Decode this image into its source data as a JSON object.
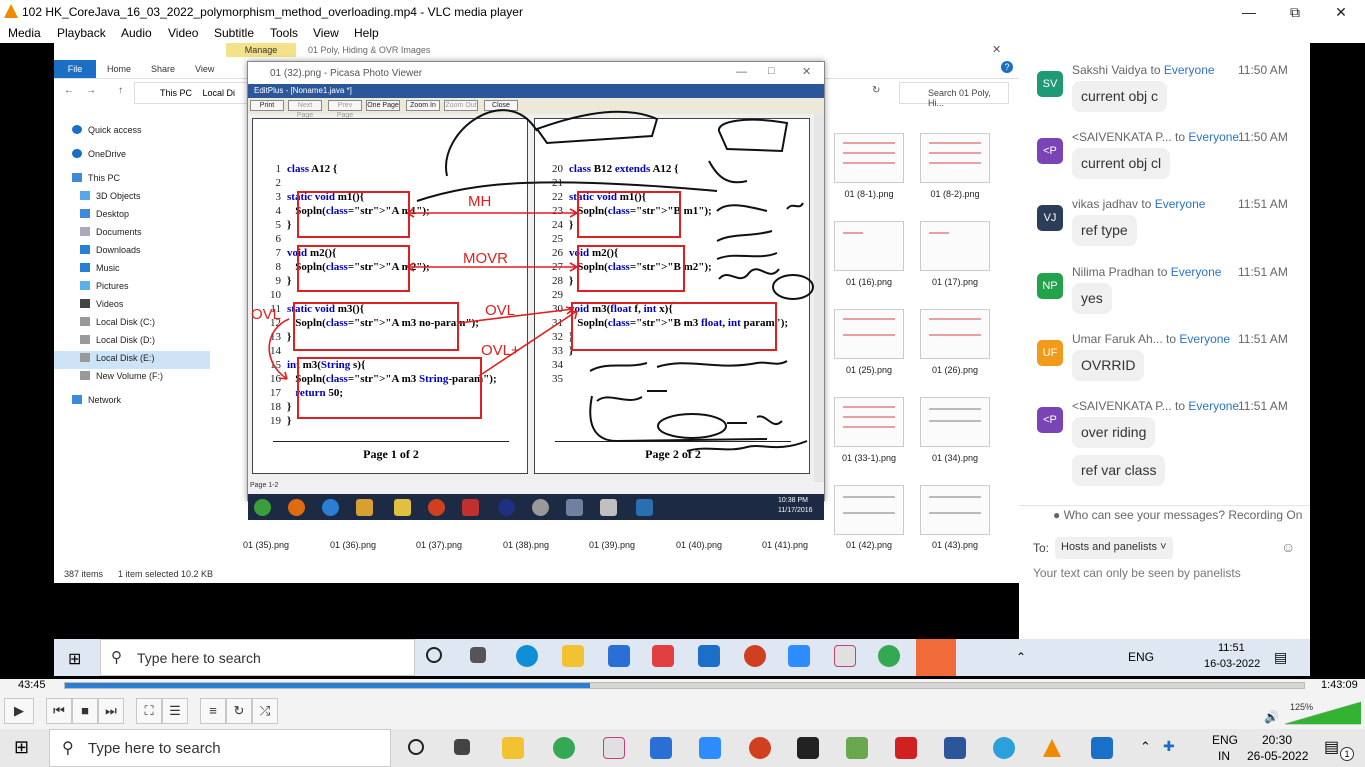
{
  "vlc": {
    "title": "102 HK_CoreJava_16_03_2022_polymorphism_method_overloading.mp4 - VLC media player",
    "menu": [
      "Media",
      "Playback",
      "Audio",
      "Video",
      "Subtitle",
      "Tools",
      "View",
      "Help"
    ],
    "time_elapsed": "43:45",
    "time_total": "1:43:09",
    "progress": 0.424,
    "volume_label": "125%"
  },
  "explorer": {
    "ribbon_tabs": [
      "File",
      "Home",
      "Share",
      "View"
    ],
    "manage_label": "Manage",
    "window_title": "01 Poly, Hiding & OVR Images",
    "breadcrumb": [
      "This PC",
      "Local Di"
    ],
    "search_placeholder": "Search 01 Poly, Hi...",
    "nav_items": [
      "Quick access",
      "OneDrive",
      "This PC",
      "3D Objects",
      "Desktop",
      "Documents",
      "Downloads",
      "Music",
      "Pictures",
      "Videos",
      "Local Disk (C:)",
      "Local Disk (D:)",
      "Local Disk (E:)",
      "New Volume (F:)",
      "Network"
    ],
    "status_items": "387 items",
    "status_selected": "1 item selected  10.2 KB",
    "thumbnails": [
      "01 (8-1).png",
      "01 (8-2).png",
      "01 (16).png",
      "01 (17).png",
      "01 (25).png",
      "01 (26).png",
      "01 (33-1).png",
      "01 (34).png",
      "01 (35).png",
      "01 (36).png",
      "01 (37).png",
      "01 (38).png",
      "01 (39).png",
      "01 (40).png",
      "01 (41).png",
      "01 (42).png",
      "01 (43).png"
    ]
  },
  "picasa": {
    "title": "01 (32).png - Picasa Photo Viewer",
    "inner_title": "EditPlus - [Noname1.java *]",
    "toolbar": [
      "Print",
      "Next Page",
      "Prev Page",
      "One Page",
      "Zoom In",
      "Zoom Out",
      "Close"
    ],
    "page1_label": "Page 1 of 2",
    "page2_label": "Page 2 of 2",
    "status": "Page 1-2",
    "clock": "10:38 PM",
    "clock_date": "11/17/2016",
    "page1_lines": [
      {
        "n": "1",
        "t": "class A12 {"
      },
      {
        "n": "2",
        "t": ""
      },
      {
        "n": "3",
        "t": "static void m1(){"
      },
      {
        "n": "4",
        "t": "   Sopln(\"A m1\");"
      },
      {
        "n": "5",
        "t": "}"
      },
      {
        "n": "6",
        "t": ""
      },
      {
        "n": "7",
        "t": "void m2(){"
      },
      {
        "n": "8",
        "t": "   Sopln(\"A m2\");"
      },
      {
        "n": "9",
        "t": "}"
      },
      {
        "n": "10",
        "t": ""
      },
      {
        "n": "11",
        "t": "static void m3(){"
      },
      {
        "n": "12",
        "t": "   Sopln(\"A m3 no-param\");"
      },
      {
        "n": "13",
        "t": "}"
      },
      {
        "n": "14",
        "t": ""
      },
      {
        "n": "15",
        "t": "int m3(String s){"
      },
      {
        "n": "16",
        "t": "   Sopln(\"A m3 String-param\");"
      },
      {
        "n": "17",
        "t": "   return 50;"
      },
      {
        "n": "18",
        "t": "}"
      },
      {
        "n": "19",
        "t": "}"
      }
    ],
    "page2_lines": [
      {
        "n": "20",
        "t": "class B12 extends A12 {"
      },
      {
        "n": "21",
        "t": ""
      },
      {
        "n": "22",
        "t": "static void m1(){"
      },
      {
        "n": "23",
        "t": "   Sopln(\"B m1\");"
      },
      {
        "n": "24",
        "t": "}"
      },
      {
        "n": "25",
        "t": ""
      },
      {
        "n": "26",
        "t": "void m2(){"
      },
      {
        "n": "27",
        "t": "   Sopln(\"B m2\");"
      },
      {
        "n": "28",
        "t": "}"
      },
      {
        "n": "29",
        "t": ""
      },
      {
        "n": "30",
        "t": "void m3(float f, int x){"
      },
      {
        "n": "31",
        "t": "   Sopln(\"B m3 float, int param\");"
      },
      {
        "n": "32",
        "t": "}"
      },
      {
        "n": "33",
        "t": "}"
      },
      {
        "n": "34",
        "t": ""
      },
      {
        "n": "35",
        "t": ""
      }
    ],
    "annotations": {
      "mh": "MH",
      "movr": "MOVR",
      "ovl_left": "OVL",
      "ovl_right": "OVL",
      "ovl_plus": "OVL+"
    }
  },
  "chat": {
    "messages": [
      {
        "initials": "SV",
        "color": "#1f9a74",
        "sender": "Sakshi Vaidya",
        "to": "Everyone",
        "time": "11:50 AM",
        "texts": [
          "current obj c"
        ]
      },
      {
        "initials": "<P",
        "color": "#7a43b6",
        "sender": "<SAIVENKATA P...",
        "to": "Everyone",
        "time": "11:50 AM",
        "texts": [
          "current obj cl"
        ]
      },
      {
        "initials": "VJ",
        "color": "#2b3e57",
        "sender": "vikas jadhav",
        "to": "Everyone",
        "time": "11:51 AM",
        "texts": [
          "ref type"
        ]
      },
      {
        "initials": "NP",
        "color": "#22a24a",
        "sender": "Nilima Pradhan",
        "to": "Everyone",
        "time": "11:51 AM",
        "texts": [
          "yes"
        ]
      },
      {
        "initials": "UF",
        "color": "#f29a1a",
        "sender": "Umar Faruk Ah...",
        "to": "Everyone",
        "time": "11:51 AM",
        "texts": [
          "OVRRID"
        ]
      },
      {
        "initials": "<P",
        "color": "#7a43b6",
        "sender": "<SAIVENKATA P...",
        "to": "Everyone",
        "time": "11:51 AM",
        "texts": [
          "over riding",
          "ref var class"
        ]
      }
    ],
    "who_can_see": "Who can see your messages? Recording On",
    "to_label": "To:",
    "to_value": "Hosts and panelists",
    "input_hint": "Your text can only be seen by panelists"
  },
  "taskbar_video": {
    "search": "Type here to search",
    "time": "11:51",
    "date": "16-03-2022",
    "lang": "ENG"
  },
  "taskbar_host": {
    "search": "Type here to search",
    "time": "20:30",
    "date": "26-05-2022",
    "lang": "ENG",
    "lang2": "IN",
    "badge": "1"
  }
}
